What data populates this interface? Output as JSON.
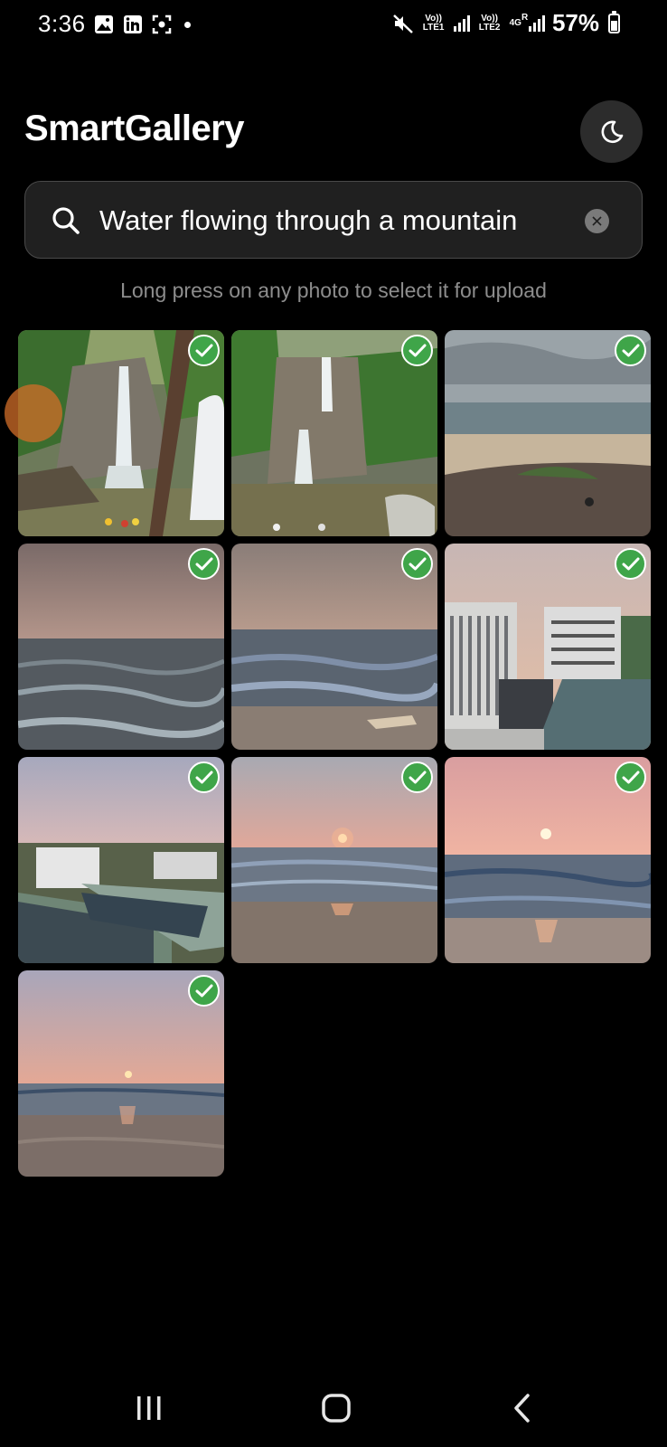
{
  "status_bar": {
    "time": "3:36",
    "sim1_label": "Vo)) LTE1",
    "sim2_label": "Vo)) LTE2",
    "network_4g": "4G",
    "roaming": "R",
    "battery_percent": "57%",
    "battery_level": 0.57,
    "icons": [
      "gallery-icon",
      "linkedin-icon",
      "screenshot-icon",
      "notification-dot",
      "mute-icon",
      "signal-icon",
      "signal-icon",
      "battery-icon"
    ]
  },
  "header": {
    "title": "SmartGallery",
    "theme_icon": "moon-icon"
  },
  "search": {
    "value": "Water flowing through a mountain",
    "icon": "search-icon",
    "clear_icon": "clear-icon"
  },
  "hint": "Long press on any photo to select it for upload",
  "photos": [
    {
      "subject": "waterfall",
      "selected": true
    },
    {
      "subject": "waterfall",
      "selected": true
    },
    {
      "subject": "beach-cloudy",
      "selected": true
    },
    {
      "subject": "sea-waves",
      "selected": true
    },
    {
      "subject": "sea-waves",
      "selected": true
    },
    {
      "subject": "buildings",
      "selected": true
    },
    {
      "subject": "rooftops",
      "selected": true
    },
    {
      "subject": "sunset-sea",
      "selected": true
    },
    {
      "subject": "sunset-sea",
      "selected": true
    },
    {
      "subject": "sunset-beach",
      "selected": true
    }
  ],
  "colors": {
    "background": "#000000",
    "search_bg": "#202020",
    "check_green": "#3fa549",
    "hint_text": "#8d8d8d"
  },
  "nav_bar": {
    "icons": [
      "recents-icon",
      "home-icon",
      "back-icon"
    ]
  }
}
